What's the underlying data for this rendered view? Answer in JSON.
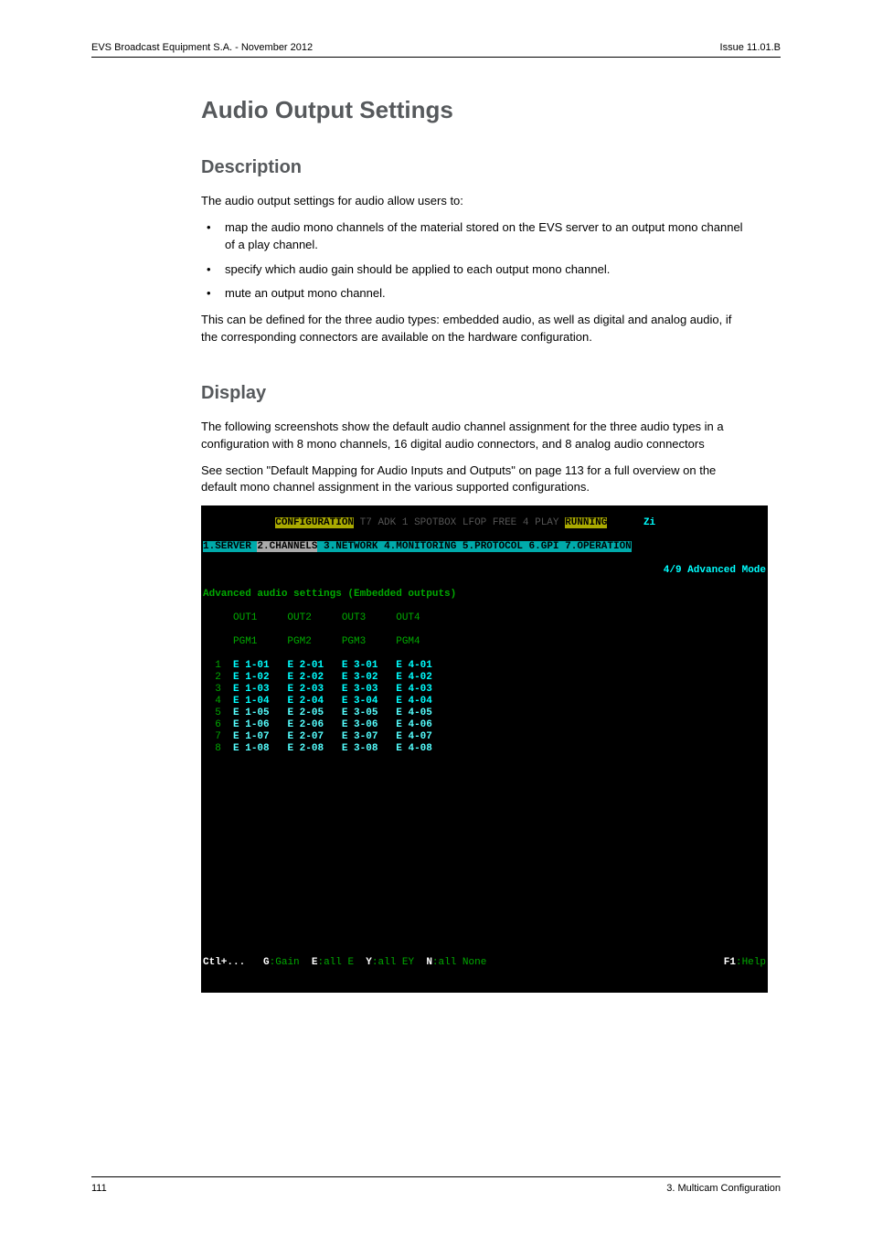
{
  "header": {
    "left": "EVS Broadcast Equipment S.A. - November 2012",
    "right": "Issue 11.01.B"
  },
  "title": "Audio Output Settings",
  "description": {
    "heading": "Description",
    "intro": "The audio output settings for audio allow users to:",
    "bullets": [
      "map the audio mono channels of the material stored on the EVS server to an output mono channel of a play channel.",
      "specify which audio gain should be applied to each output mono channel.",
      "mute an output mono channel."
    ],
    "after": "This can be defined for the three audio types: embedded audio, as well as digital and analog audio, if the corresponding connectors are available on the hardware configuration."
  },
  "display": {
    "heading": "Display",
    "p1": "The following screenshots show the default audio channel assignment for the three audio types in a configuration with 8 mono channels, 16 digital audio connectors, and 8 analog audio connectors",
    "p2": "See section \"Default Mapping for Audio Inputs and Outputs\" on page 113 for a full overview on the default mono channel assignment in the various supported configurations."
  },
  "terminal": {
    "title_left": "CONFIGURATION",
    "title_mid_dim": "T7 ADK 1 SPOTBOX LFOP FREE 4 PLAY",
    "title_status": "RUNNING",
    "title_right": "Zi",
    "menu": {
      "items": [
        "1.SERVER",
        "2.CHANNELS",
        "3.NETWORK",
        "4.MONITORING",
        "5.PROTOCOL",
        "6.GPI",
        "7.OPERATION"
      ],
      "active_index": 1
    },
    "pager": "4/9 Advanced Mode",
    "section_title": "Advanced audio settings (Embedded outputs)",
    "col_headers": [
      "OUT1",
      "OUT2",
      "OUT3",
      "OUT4"
    ],
    "pgm_headers": [
      "PGM1",
      "PGM2",
      "PGM3",
      "PGM4"
    ],
    "rows": [
      {
        "n": "1",
        "c": [
          "E 1-01",
          "E 2-01",
          "E 3-01",
          "E 4-01"
        ]
      },
      {
        "n": "2",
        "c": [
          "E 1-02",
          "E 2-02",
          "E 3-02",
          "E 4-02"
        ]
      },
      {
        "n": "3",
        "c": [
          "E 1-03",
          "E 2-03",
          "E 3-03",
          "E 4-03"
        ]
      },
      {
        "n": "4",
        "c": [
          "E 1-04",
          "E 2-04",
          "E 3-04",
          "E 4-04"
        ]
      },
      {
        "n": "5",
        "c": [
          "E 1-05",
          "E 2-05",
          "E 3-05",
          "E 4-05"
        ]
      },
      {
        "n": "6",
        "c": [
          "E 1-06",
          "E 2-06",
          "E 3-06",
          "E 4-06"
        ]
      },
      {
        "n": "7",
        "c": [
          "E 1-07",
          "E 2-07",
          "E 3-07",
          "E 4-07"
        ]
      },
      {
        "n": "8",
        "c": [
          "E 1-08",
          "E 2-08",
          "E 3-08",
          "E 4-08"
        ]
      }
    ],
    "footer": {
      "ctl": "Ctl+...",
      "g_key": "G",
      "g_val": ":Gain",
      "e_key": "E",
      "e_val": ":all E",
      "y_key": "Y",
      "y_val": ":all EY",
      "n_key": "N",
      "n_val": ":all None",
      "f1_key": "F1",
      "f1_val": ":Help"
    }
  },
  "footer": {
    "page_no": "111",
    "section": "3. Multicam Configuration"
  }
}
